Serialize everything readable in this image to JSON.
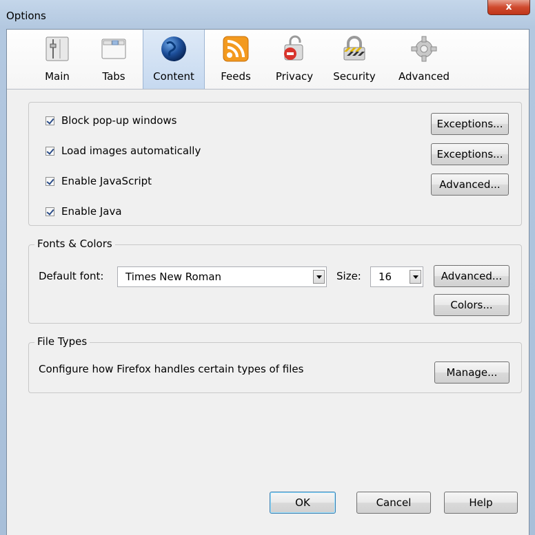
{
  "window": {
    "title": "Options",
    "close_label": "x"
  },
  "tabs": [
    {
      "label": "Main",
      "icon": "main-icon"
    },
    {
      "label": "Tabs",
      "icon": "tabs-icon"
    },
    {
      "label": "Content",
      "icon": "globe-icon",
      "selected": true
    },
    {
      "label": "Feeds",
      "icon": "rss-icon"
    },
    {
      "label": "Privacy",
      "icon": "privacy-mask-icon"
    },
    {
      "label": "Security",
      "icon": "padlock-icon"
    },
    {
      "label": "Advanced",
      "icon": "gear-icon"
    }
  ],
  "content": {
    "options": [
      {
        "label": "Block pop-up windows",
        "checked": true,
        "button": "Exceptions..."
      },
      {
        "label": "Load images automatically",
        "checked": true,
        "button": "Exceptions..."
      },
      {
        "label": "Enable JavaScript",
        "checked": true,
        "button": "Advanced..."
      },
      {
        "label": "Enable Java",
        "checked": true
      }
    ]
  },
  "fonts": {
    "legend": "Fonts & Colors",
    "default_font_label": "Default font:",
    "default_font_value": "Times New Roman",
    "size_label": "Size:",
    "size_value": "16",
    "advanced_button": "Advanced...",
    "colors_button": "Colors..."
  },
  "file_types": {
    "legend": "File Types",
    "description": "Configure how Firefox handles certain types of files",
    "manage_button": "Manage..."
  },
  "footer": {
    "ok": "OK",
    "cancel": "Cancel",
    "help": "Help"
  },
  "colors": {
    "selected_tab": "#c6d9f0",
    "close_button": "#cf4a2e",
    "dialog_bg": "#f0f0f0"
  }
}
